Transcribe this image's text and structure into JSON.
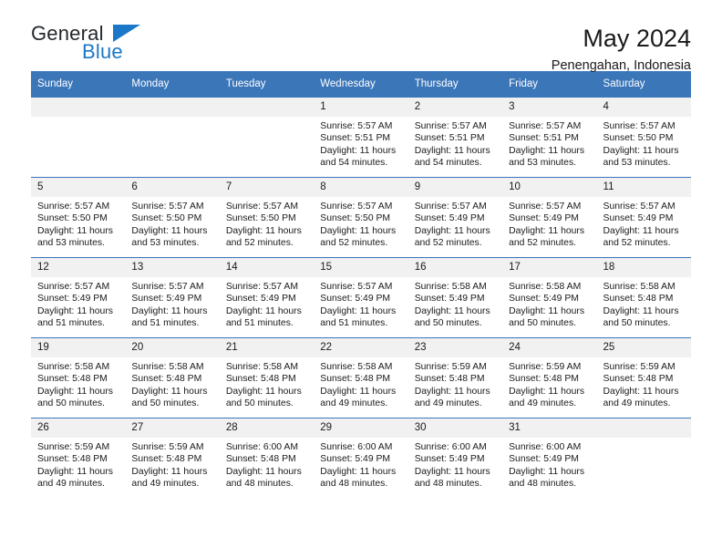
{
  "brand": {
    "line1": "General",
    "line2": "Blue",
    "triangle_icon": "triangle-icon",
    "color_black": "#23282c",
    "color_blue": "#1b77c8"
  },
  "header": {
    "title": "May 2024",
    "subtitle": "Penengahan, Indonesia"
  },
  "theme": {
    "header_blue": "#3b76b9",
    "daynum_gray": "#f1f1f1",
    "text": "#1a1a1a"
  },
  "calendar": {
    "weekday_headers": [
      "Sunday",
      "Monday",
      "Tuesday",
      "Wednesday",
      "Thursday",
      "Friday",
      "Saturday"
    ],
    "labels": {
      "sunrise": "Sunrise:",
      "sunset": "Sunset:",
      "daylight": "Daylight:"
    },
    "weeks": [
      [
        {
          "day": "",
          "empty": true
        },
        {
          "day": "",
          "empty": true
        },
        {
          "day": "",
          "empty": true
        },
        {
          "day": "1",
          "sunrise": "Sunrise: 5:57 AM",
          "sunset": "Sunset: 5:51 PM",
          "daylight_1": "Daylight: 11 hours",
          "daylight_2": "and 54 minutes."
        },
        {
          "day": "2",
          "sunrise": "Sunrise: 5:57 AM",
          "sunset": "Sunset: 5:51 PM",
          "daylight_1": "Daylight: 11 hours",
          "daylight_2": "and 54 minutes."
        },
        {
          "day": "3",
          "sunrise": "Sunrise: 5:57 AM",
          "sunset": "Sunset: 5:51 PM",
          "daylight_1": "Daylight: 11 hours",
          "daylight_2": "and 53 minutes."
        },
        {
          "day": "4",
          "sunrise": "Sunrise: 5:57 AM",
          "sunset": "Sunset: 5:50 PM",
          "daylight_1": "Daylight: 11 hours",
          "daylight_2": "and 53 minutes."
        }
      ],
      [
        {
          "day": "5",
          "sunrise": "Sunrise: 5:57 AM",
          "sunset": "Sunset: 5:50 PM",
          "daylight_1": "Daylight: 11 hours",
          "daylight_2": "and 53 minutes."
        },
        {
          "day": "6",
          "sunrise": "Sunrise: 5:57 AM",
          "sunset": "Sunset: 5:50 PM",
          "daylight_1": "Daylight: 11 hours",
          "daylight_2": "and 53 minutes."
        },
        {
          "day": "7",
          "sunrise": "Sunrise: 5:57 AM",
          "sunset": "Sunset: 5:50 PM",
          "daylight_1": "Daylight: 11 hours",
          "daylight_2": "and 52 minutes."
        },
        {
          "day": "8",
          "sunrise": "Sunrise: 5:57 AM",
          "sunset": "Sunset: 5:50 PM",
          "daylight_1": "Daylight: 11 hours",
          "daylight_2": "and 52 minutes."
        },
        {
          "day": "9",
          "sunrise": "Sunrise: 5:57 AM",
          "sunset": "Sunset: 5:49 PM",
          "daylight_1": "Daylight: 11 hours",
          "daylight_2": "and 52 minutes."
        },
        {
          "day": "10",
          "sunrise": "Sunrise: 5:57 AM",
          "sunset": "Sunset: 5:49 PM",
          "daylight_1": "Daylight: 11 hours",
          "daylight_2": "and 52 minutes."
        },
        {
          "day": "11",
          "sunrise": "Sunrise: 5:57 AM",
          "sunset": "Sunset: 5:49 PM",
          "daylight_1": "Daylight: 11 hours",
          "daylight_2": "and 52 minutes."
        }
      ],
      [
        {
          "day": "12",
          "sunrise": "Sunrise: 5:57 AM",
          "sunset": "Sunset: 5:49 PM",
          "daylight_1": "Daylight: 11 hours",
          "daylight_2": "and 51 minutes."
        },
        {
          "day": "13",
          "sunrise": "Sunrise: 5:57 AM",
          "sunset": "Sunset: 5:49 PM",
          "daylight_1": "Daylight: 11 hours",
          "daylight_2": "and 51 minutes."
        },
        {
          "day": "14",
          "sunrise": "Sunrise: 5:57 AM",
          "sunset": "Sunset: 5:49 PM",
          "daylight_1": "Daylight: 11 hours",
          "daylight_2": "and 51 minutes."
        },
        {
          "day": "15",
          "sunrise": "Sunrise: 5:57 AM",
          "sunset": "Sunset: 5:49 PM",
          "daylight_1": "Daylight: 11 hours",
          "daylight_2": "and 51 minutes."
        },
        {
          "day": "16",
          "sunrise": "Sunrise: 5:58 AM",
          "sunset": "Sunset: 5:49 PM",
          "daylight_1": "Daylight: 11 hours",
          "daylight_2": "and 50 minutes."
        },
        {
          "day": "17",
          "sunrise": "Sunrise: 5:58 AM",
          "sunset": "Sunset: 5:49 PM",
          "daylight_1": "Daylight: 11 hours",
          "daylight_2": "and 50 minutes."
        },
        {
          "day": "18",
          "sunrise": "Sunrise: 5:58 AM",
          "sunset": "Sunset: 5:48 PM",
          "daylight_1": "Daylight: 11 hours",
          "daylight_2": "and 50 minutes."
        }
      ],
      [
        {
          "day": "19",
          "sunrise": "Sunrise: 5:58 AM",
          "sunset": "Sunset: 5:48 PM",
          "daylight_1": "Daylight: 11 hours",
          "daylight_2": "and 50 minutes."
        },
        {
          "day": "20",
          "sunrise": "Sunrise: 5:58 AM",
          "sunset": "Sunset: 5:48 PM",
          "daylight_1": "Daylight: 11 hours",
          "daylight_2": "and 50 minutes."
        },
        {
          "day": "21",
          "sunrise": "Sunrise: 5:58 AM",
          "sunset": "Sunset: 5:48 PM",
          "daylight_1": "Daylight: 11 hours",
          "daylight_2": "and 50 minutes."
        },
        {
          "day": "22",
          "sunrise": "Sunrise: 5:58 AM",
          "sunset": "Sunset: 5:48 PM",
          "daylight_1": "Daylight: 11 hours",
          "daylight_2": "and 49 minutes."
        },
        {
          "day": "23",
          "sunrise": "Sunrise: 5:59 AM",
          "sunset": "Sunset: 5:48 PM",
          "daylight_1": "Daylight: 11 hours",
          "daylight_2": "and 49 minutes."
        },
        {
          "day": "24",
          "sunrise": "Sunrise: 5:59 AM",
          "sunset": "Sunset: 5:48 PM",
          "daylight_1": "Daylight: 11 hours",
          "daylight_2": "and 49 minutes."
        },
        {
          "day": "25",
          "sunrise": "Sunrise: 5:59 AM",
          "sunset": "Sunset: 5:48 PM",
          "daylight_1": "Daylight: 11 hours",
          "daylight_2": "and 49 minutes."
        }
      ],
      [
        {
          "day": "26",
          "sunrise": "Sunrise: 5:59 AM",
          "sunset": "Sunset: 5:48 PM",
          "daylight_1": "Daylight: 11 hours",
          "daylight_2": "and 49 minutes."
        },
        {
          "day": "27",
          "sunrise": "Sunrise: 5:59 AM",
          "sunset": "Sunset: 5:48 PM",
          "daylight_1": "Daylight: 11 hours",
          "daylight_2": "and 49 minutes."
        },
        {
          "day": "28",
          "sunrise": "Sunrise: 6:00 AM",
          "sunset": "Sunset: 5:48 PM",
          "daylight_1": "Daylight: 11 hours",
          "daylight_2": "and 48 minutes."
        },
        {
          "day": "29",
          "sunrise": "Sunrise: 6:00 AM",
          "sunset": "Sunset: 5:49 PM",
          "daylight_1": "Daylight: 11 hours",
          "daylight_2": "and 48 minutes."
        },
        {
          "day": "30",
          "sunrise": "Sunrise: 6:00 AM",
          "sunset": "Sunset: 5:49 PM",
          "daylight_1": "Daylight: 11 hours",
          "daylight_2": "and 48 minutes."
        },
        {
          "day": "31",
          "sunrise": "Sunrise: 6:00 AM",
          "sunset": "Sunset: 5:49 PM",
          "daylight_1": "Daylight: 11 hours",
          "daylight_2": "and 48 minutes."
        },
        {
          "day": "",
          "empty": true
        }
      ]
    ]
  }
}
